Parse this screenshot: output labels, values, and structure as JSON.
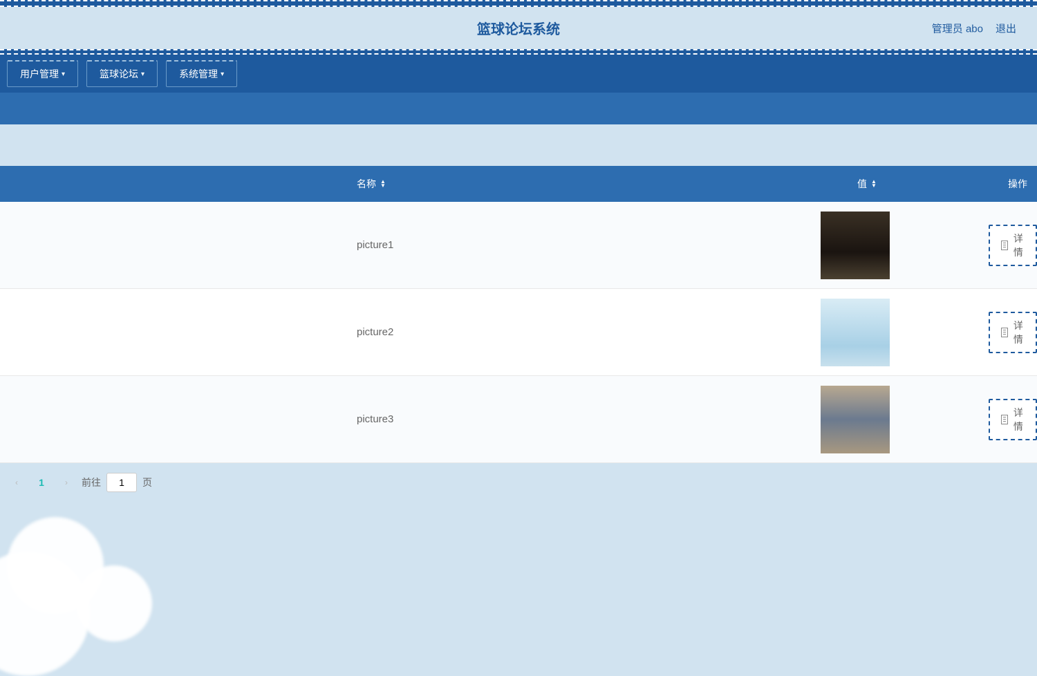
{
  "header": {
    "title": "篮球论坛系统",
    "admin_label": "管理员 abo",
    "logout_label": "退出"
  },
  "nav": [
    {
      "label": "用户管理"
    },
    {
      "label": "篮球论坛"
    },
    {
      "label": "系统管理"
    }
  ],
  "table": {
    "columns": {
      "name": "名称",
      "value": "值",
      "action": "操作"
    },
    "rows": [
      {
        "name": "picture1",
        "img": "img1",
        "detail": "详情"
      },
      {
        "name": "picture2",
        "img": "img2",
        "detail": "详情"
      },
      {
        "name": "picture3",
        "img": "img3",
        "detail": "详情"
      }
    ]
  },
  "pagination": {
    "current": "1",
    "goto_prefix": "前往",
    "goto_suffix": "页",
    "goto_value": "1"
  }
}
